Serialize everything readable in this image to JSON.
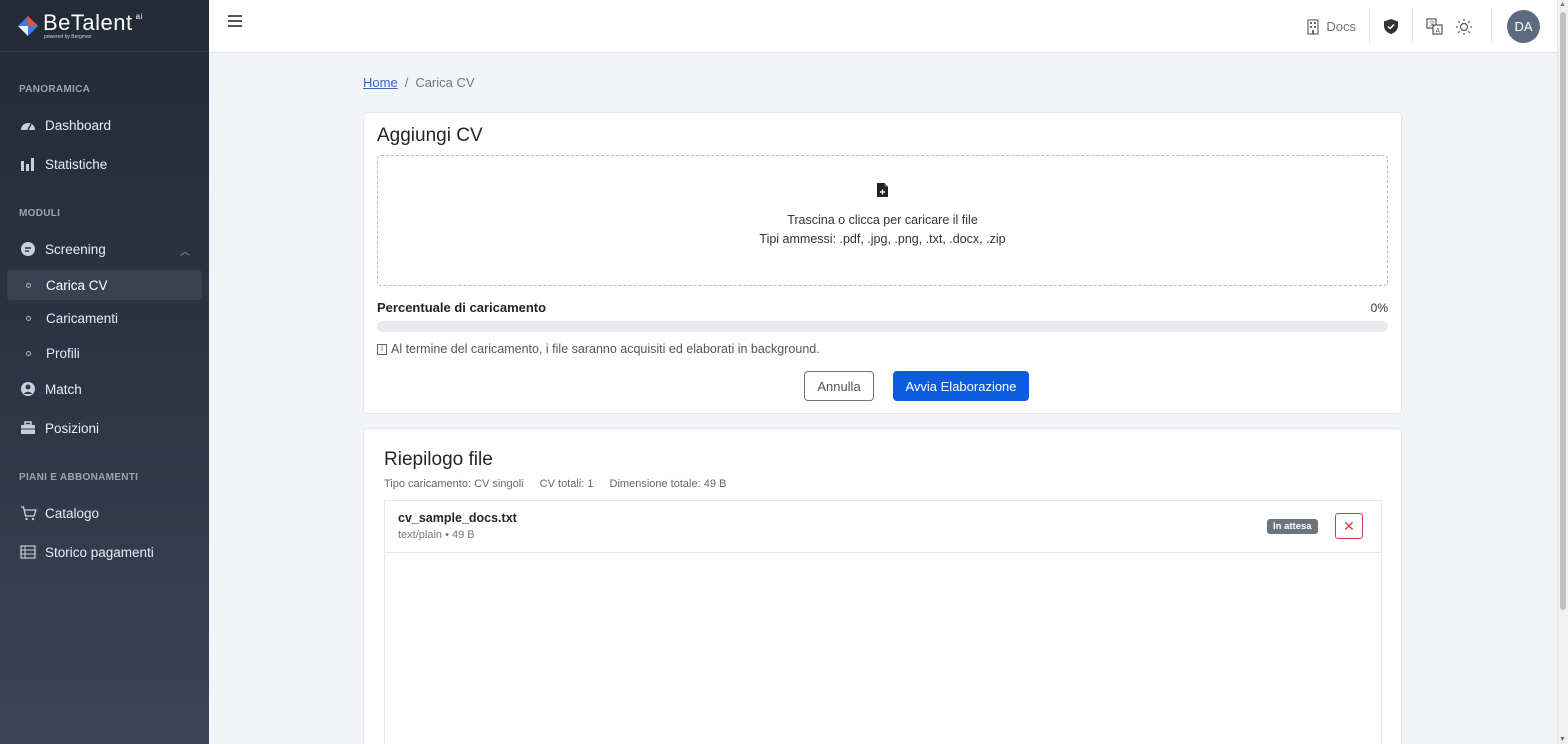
{
  "brand": {
    "name": "BeTalent",
    "sup": "ai",
    "sub": "powered by Bergman"
  },
  "sidebar": {
    "sections": [
      {
        "label": "PANORAMICA"
      },
      {
        "label": "MODULI"
      },
      {
        "label": "PIANI E ABBONAMENTI"
      }
    ],
    "items": [
      {
        "label": "Dashboard",
        "icon": "gauge-icon"
      },
      {
        "label": "Statistiche",
        "icon": "bar-chart-icon"
      },
      {
        "label": "Screening",
        "icon": "screening-icon"
      },
      {
        "label": "Carica CV"
      },
      {
        "label": "Caricamenti"
      },
      {
        "label": "Profili"
      },
      {
        "label": "Match",
        "icon": "user-circle-icon"
      },
      {
        "label": "Posizioni",
        "icon": "briefcase-icon"
      },
      {
        "label": "Catalogo",
        "icon": "cart-icon"
      },
      {
        "label": "Storico pagamenti",
        "icon": "table-icon"
      }
    ]
  },
  "topbar": {
    "docs_label": "Docs",
    "avatar_initials": "DA"
  },
  "breadcrumb": {
    "home": "Home",
    "current": "Carica CV"
  },
  "upload": {
    "title": "Aggiungi CV",
    "drop_text": "Trascina o clicca per caricare il file",
    "allowed_types": "Tipi ammessi: .pdf, .jpg, .png, .txt, .docx, .zip",
    "progress_label": "Percentuale di caricamento",
    "progress_value": "0%",
    "progress_fraction": 0,
    "info_box": "i",
    "info_text": "Al termine del caricamento, i file saranno acquisiti ed elaborati in background.",
    "cancel_label": "Annulla",
    "start_label": "Avvia Elaborazione"
  },
  "summary": {
    "title": "Riepilogo file",
    "upload_type": "Tipo caricamento: CV singoli",
    "total_cv": "CV totali: 1",
    "total_size": "Dimensione totale: 49 B",
    "files": [
      {
        "name": "cv_sample_docs.txt",
        "info": "text/plain • 49 B",
        "status": "In attesa"
      }
    ]
  },
  "colors": {
    "primary": "#0d5ce0",
    "danger": "#dc3545",
    "sidebar": "#2e3547"
  }
}
